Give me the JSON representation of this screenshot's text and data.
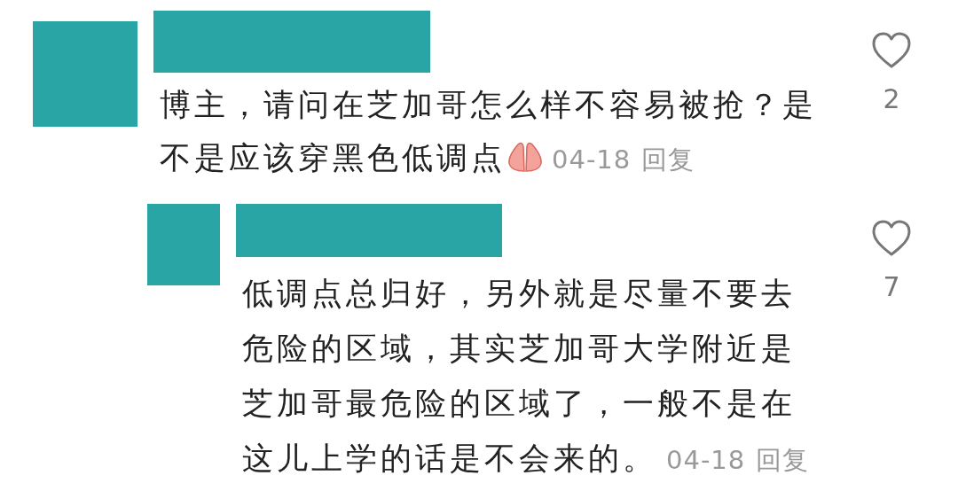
{
  "comments": [
    {
      "text": "博主，请问在芝加哥怎么样不容易被抢？是不是应该穿黑色低调点",
      "emoji": true,
      "date": "04-18",
      "reply_label": "回复",
      "likes": "2",
      "liked": false,
      "nested": false
    },
    {
      "text": "低调点总归好，另外就是尽量不要去危险的区域，其实芝加哥大学附近是芝加哥最危险的区域了，一般不是在这儿上学的话是不会来的。",
      "date": "04-18",
      "reply_label": "回复",
      "likes": "7",
      "liked": false,
      "nested": true
    }
  ]
}
